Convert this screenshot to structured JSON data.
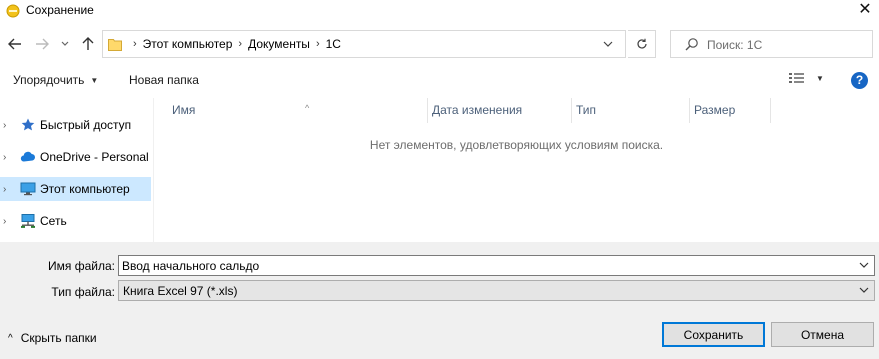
{
  "window": {
    "title": "Сохранение",
    "close_glyph": "✕"
  },
  "nav": {
    "breadcrumb": [
      "Этот компьютер",
      "Документы",
      "1C"
    ],
    "search_placeholder": "Поиск: 1C"
  },
  "toolbar": {
    "organize_label": "Упорядочить",
    "new_folder_label": "Новая папка",
    "help_glyph": "?"
  },
  "tree": {
    "items": [
      {
        "label": "Быстрый доступ",
        "icon": "star-icon",
        "selected": false
      },
      {
        "label": "OneDrive - Personal",
        "icon": "cloud-icon",
        "selected": false
      },
      {
        "label": "Этот компьютер",
        "icon": "computer-icon",
        "selected": true
      },
      {
        "label": "Сеть",
        "icon": "network-icon",
        "selected": false
      }
    ]
  },
  "files": {
    "columns": [
      "Имя",
      "Дата изменения",
      "Тип",
      "Размер"
    ],
    "empty_message": "Нет элементов, удовлетворяющих условиям поиска."
  },
  "form": {
    "filename_label": "Имя файла:",
    "filename_value": "Ввод начального сальдо",
    "filetype_label": "Тип файла:",
    "filetype_value": "Книга Excel 97 (*.xls)"
  },
  "footer": {
    "hide_folders_label": "Скрыть папки",
    "save_label": "Сохранить",
    "cancel_label": "Отмена"
  },
  "colors": {
    "accent": "#0078d7",
    "selected_bg": "#cce8ff",
    "help_blue": "#1766c4"
  }
}
